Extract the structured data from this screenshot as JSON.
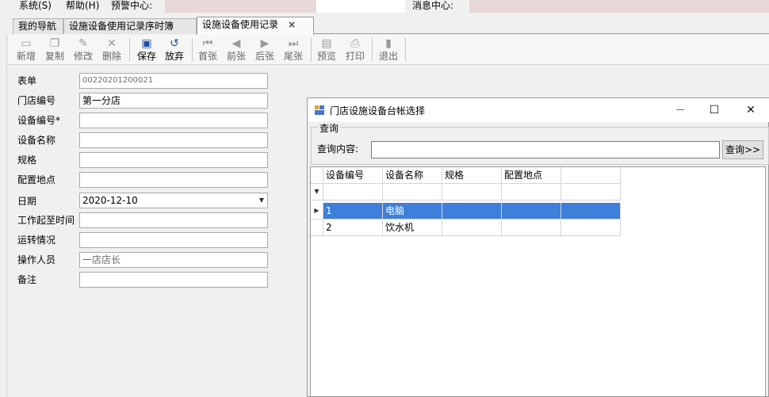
{
  "menu": {
    "system": "系统(S)",
    "help": "帮助(H)",
    "alert_center": "预警中心:",
    "message_center": "消息中心:"
  },
  "tabs": [
    {
      "label": "我的导航"
    },
    {
      "label": "设施设备使用记录序时簿"
    },
    {
      "label": "设施设备使用记录",
      "close": "×"
    }
  ],
  "toolbar": {
    "new": "新增",
    "copy": "复制",
    "edit": "修改",
    "delete": "删除",
    "save": "保存",
    "discard": "放弃",
    "first": "首张",
    "prev": "前张",
    "next": "后张",
    "last": "尾张",
    "preview": "预览",
    "print": "打印",
    "exit": "退出"
  },
  "form": {
    "fields": [
      {
        "label": "表单",
        "value": "00220201200021"
      },
      {
        "label": "门店编号",
        "value": "第一分店"
      },
      {
        "label": "设备编号*",
        "value": ""
      },
      {
        "label": "设备名称",
        "value": ""
      },
      {
        "label": "规格",
        "value": ""
      },
      {
        "label": "配置地点",
        "value": ""
      },
      {
        "label": "日期",
        "value": "2020-12-10"
      },
      {
        "label": "工作起至时间",
        "value": ""
      },
      {
        "label": "运转情况",
        "value": ""
      },
      {
        "label": "操作人员",
        "value": "一店店长"
      },
      {
        "label": "备注",
        "value": ""
      }
    ]
  },
  "dialog": {
    "title": "门店设施设备台帐选择",
    "minimize": "—",
    "maximize": "☐",
    "close": "✕",
    "group_label": "查询",
    "query_label": "查询内容:",
    "query_value": "",
    "query_button": "查询>>",
    "columns": [
      "设备编号",
      "设备名称",
      "规格",
      "配置地点",
      ""
    ],
    "rows": [
      [
        "1",
        "电脑",
        "",
        "",
        ""
      ],
      [
        "2",
        "饮水机",
        "",
        "",
        ""
      ]
    ],
    "selected_row": 1
  },
  "colors": {
    "selection": "#3d7fd9",
    "toolbar_active_icon": "#1f4fa8"
  }
}
